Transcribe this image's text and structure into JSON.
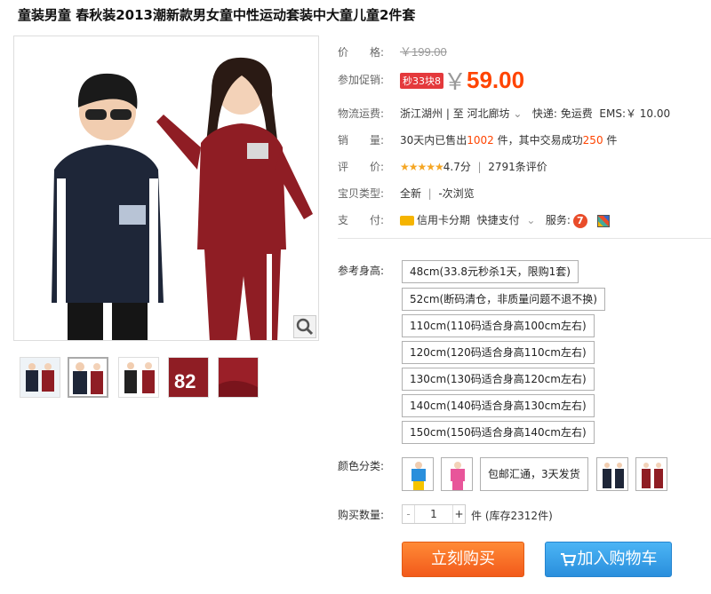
{
  "title": "童装男童 春秋装2013潮新款男女童中性运动套装中大童儿童2件套",
  "price": {
    "label": "价　　格:",
    "original": "￥199.00"
  },
  "promo": {
    "label": "参加促销:",
    "badge": "秒33块8",
    "currency": "￥",
    "value": "59.00"
  },
  "shipping": {
    "label": "物流运费:",
    "from": "浙江湖州",
    "sep": "| 至",
    "to": "河北廊坊",
    "arrow": "⌄",
    "express": "快递: 免运费",
    "ems": "EMS:￥ 10.00"
  },
  "sales": {
    "label": "销　　量:",
    "prefix": "30天内已售出",
    "sold": "1002",
    "mid": "件，其中交易成功",
    "success": "250",
    "suffix": "件"
  },
  "rating": {
    "label": "评　　价:",
    "stars": "★★★★★",
    "score": "4.7分",
    "sep": "|",
    "count": "2791条评价"
  },
  "type": {
    "label": "宝贝类型:",
    "value": "全新",
    "sep": "|",
    "views": "-次浏览"
  },
  "payment": {
    "label": "支　　付:",
    "installment": "信用卡分期",
    "quick": "快捷支付",
    "arrow": "⌄",
    "service_label": "服务:",
    "service1": "7"
  },
  "height": {
    "label": "参考身高:",
    "options": [
      "48cm(33.8元秒杀1天，限购1套)",
      "52cm(断码清仓，非质量问题不退不换)",
      "110cm(110码适合身高100cm左右)",
      "120cm(120码适合身高110cm左右)",
      "130cm(130码适合身高120cm左右)",
      "140cm(140码适合身高130cm左右)",
      "150cm(150码适合身高140cm左右)"
    ]
  },
  "color": {
    "label": "颜色分类:",
    "text_option": "包邮汇通，3天发货"
  },
  "quantity": {
    "label": "购买数量:",
    "minus": "-",
    "value": "1",
    "plus": "+",
    "unit": "件",
    "stock": "(库存2312件)"
  },
  "buttons": {
    "buy": "立刻购买",
    "cart": "加入购物车"
  },
  "colors": {
    "accent": "#ff4400",
    "buy": "#f25a1b",
    "cart": "#2a8fdc"
  }
}
